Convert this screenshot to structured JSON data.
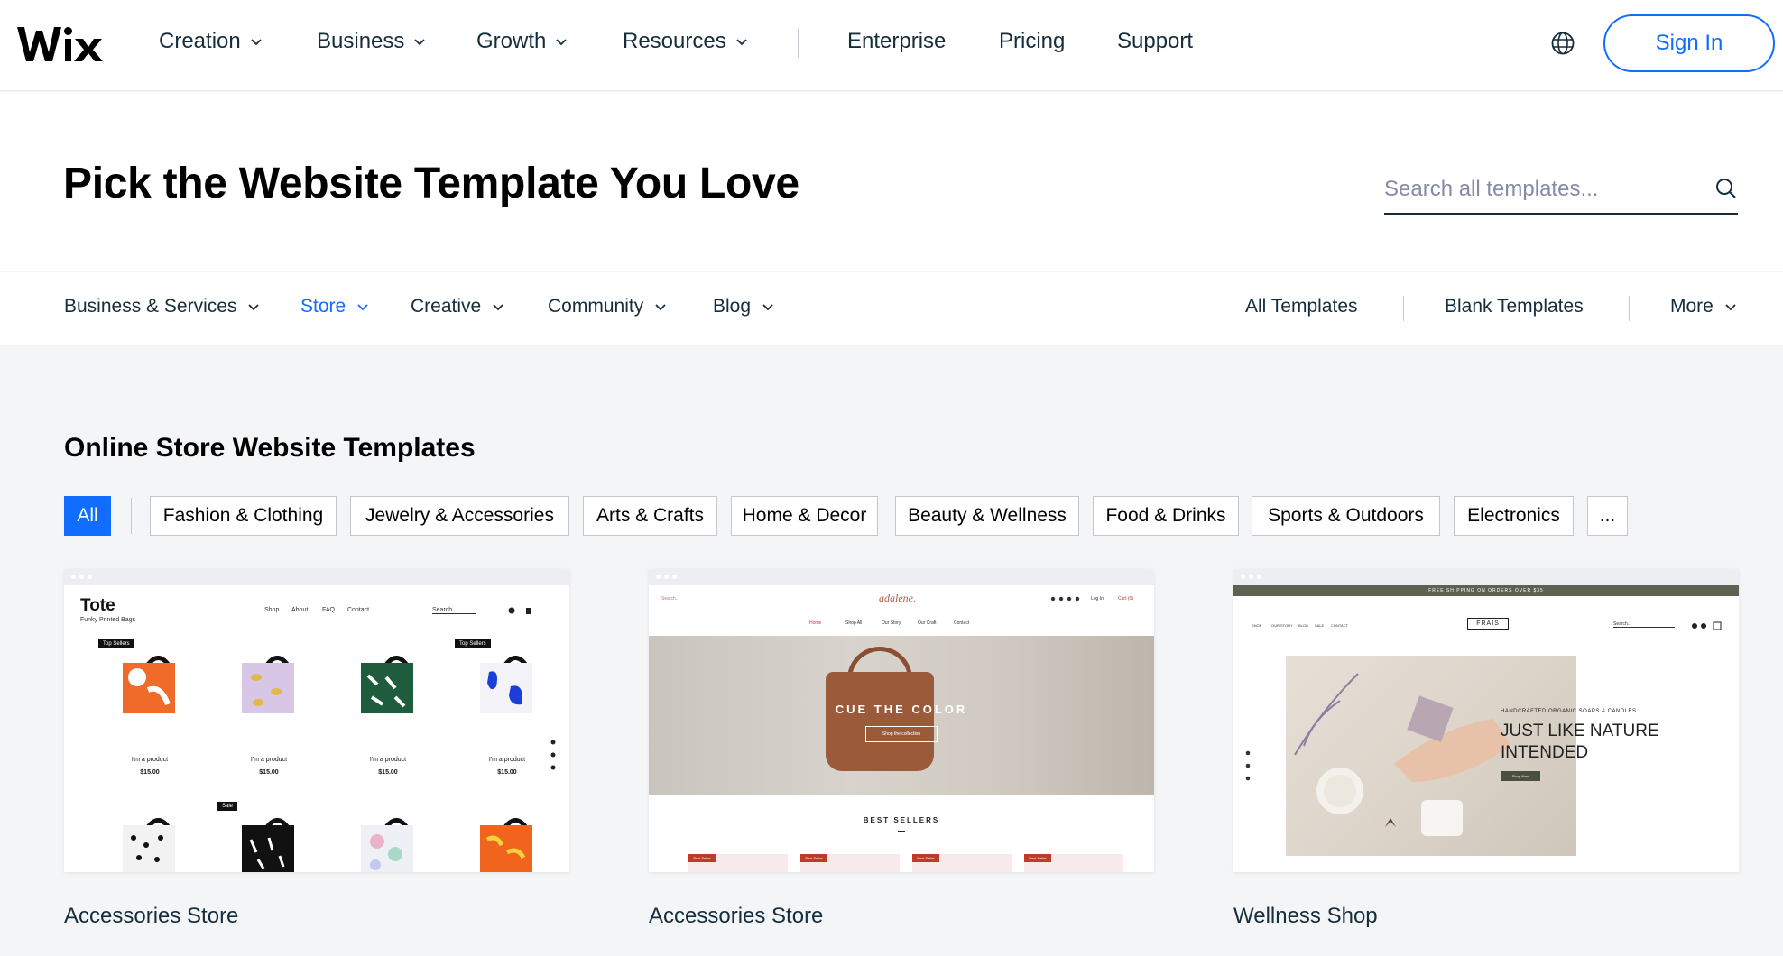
{
  "brand": {
    "logo_text": "WIX"
  },
  "topnav": {
    "items": [
      {
        "label": "Creation",
        "dropdown": true
      },
      {
        "label": "Business",
        "dropdown": true
      },
      {
        "label": "Growth",
        "dropdown": true
      },
      {
        "label": "Resources",
        "dropdown": true
      },
      {
        "label": "Enterprise",
        "dropdown": false
      },
      {
        "label": "Pricing",
        "dropdown": false
      },
      {
        "label": "Support",
        "dropdown": false
      }
    ],
    "language_icon": "globe-icon",
    "signin_label": "Sign In"
  },
  "hero": {
    "title": "Pick the Website Template You Love",
    "search_placeholder": "Search all templates...",
    "search_icon": "search-icon"
  },
  "categories": {
    "items": [
      {
        "label": "Business & Services",
        "active": false
      },
      {
        "label": "Store",
        "active": true
      },
      {
        "label": "Creative",
        "active": false
      },
      {
        "label": "Community",
        "active": false
      },
      {
        "label": "Blog",
        "active": false
      }
    ],
    "right": {
      "all_templates": "All Templates",
      "blank_templates": "Blank Templates",
      "more": "More"
    }
  },
  "section": {
    "title": "Online Store Website Templates",
    "filters": [
      {
        "label": "All",
        "active": true
      },
      {
        "label": "Fashion & Clothing",
        "active": false
      },
      {
        "label": "Jewelry & Accessories",
        "active": false
      },
      {
        "label": "Arts & Crafts",
        "active": false
      },
      {
        "label": "Home & Decor",
        "active": false
      },
      {
        "label": "Beauty & Wellness",
        "active": false
      },
      {
        "label": "Food & Drinks",
        "active": false
      },
      {
        "label": "Sports & Outdoors",
        "active": false
      },
      {
        "label": "Electronics",
        "active": false
      },
      {
        "label": "...",
        "active": false
      }
    ]
  },
  "templates": [
    {
      "name": "Accessories Store",
      "preview": {
        "brand": "Tote",
        "tagline": "Funky Printed Bags",
        "nav": [
          "Shop",
          "About",
          "FAQ",
          "Contact"
        ],
        "search": "Search...",
        "badges": [
          "Top Sellers",
          "Top Sellers",
          "Sale"
        ],
        "product_label": "I'm a product",
        "price": "$15.00"
      }
    },
    {
      "name": "Accessories Store",
      "preview": {
        "brand": "adalene.",
        "search": "Search...",
        "nav": [
          "Home",
          "Shop All",
          "Our Story",
          "Our Craft",
          "Contact"
        ],
        "login": "Log In",
        "cart": "Cart (0)",
        "headline": "CUE THE COLOR",
        "button": "Shop the collection",
        "section": "BEST SELLERS",
        "badge": "Best Seller"
      }
    },
    {
      "name": "Wellness Shop",
      "preview": {
        "announcement": "FREE SHIPPING ON ORDERS OVER $35",
        "brand": "FRAIS",
        "nav": [
          "SHOP",
          "OUR STORY",
          "BLOG",
          "SALE",
          "CONTACT"
        ],
        "search": "Search...",
        "kicker": "HANDCRAFTED ORGANIC SOAPS & CANDLES",
        "headline_line1": "JUST LIKE NATURE",
        "headline_line2": "INTENDED",
        "button": "Shop Now"
      }
    }
  ],
  "colors": {
    "accent": "#116dff",
    "text": "#162d3d",
    "page_bg": "#f4f5f7"
  }
}
